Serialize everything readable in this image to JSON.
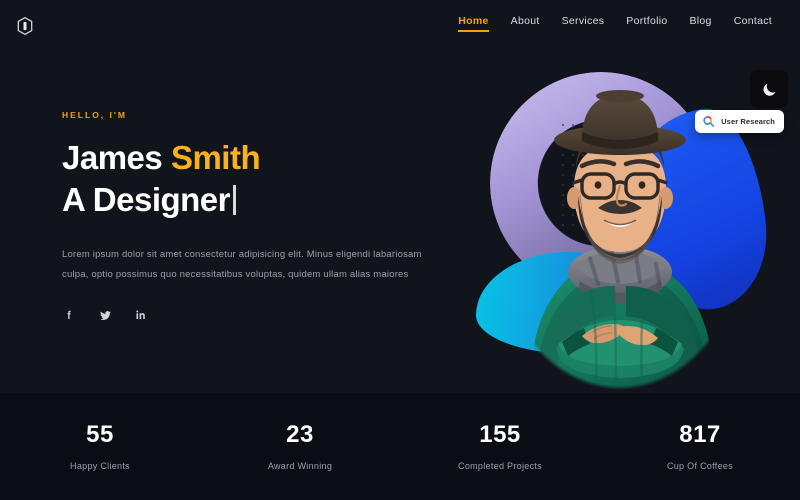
{
  "site": {
    "logo_icon": "monogram-logo-icon",
    "background_color": "#12141c",
    "accent_color": "#eda312"
  },
  "header": {
    "nav": [
      {
        "label": "Home",
        "active": true
      },
      {
        "label": "About",
        "active": false
      },
      {
        "label": "Services",
        "active": false
      },
      {
        "label": "Portfolio",
        "active": false
      },
      {
        "label": "Blog",
        "active": false
      },
      {
        "label": "Contact",
        "active": false
      }
    ]
  },
  "mode_toggle": {
    "icon": "moon-icon",
    "state": "dark"
  },
  "hero": {
    "greeting": "HELLO, I'M",
    "name_first": "James ",
    "name_last": "Smith",
    "role": "A Designer",
    "lead": "Lorem ipsum dolor sit amet consectetur adipisicing elit. Minus eligendi labariosam culpa, optio possimus quo necessitatibus voluptas, quidem ullam alias maiores",
    "socials": [
      {
        "name": "facebook-icon",
        "label": "Facebook"
      },
      {
        "name": "twitter-icon",
        "label": "Twitter"
      },
      {
        "name": "linkedin-icon",
        "label": "LinkedIn"
      }
    ],
    "badge": {
      "text": "User Research",
      "icon": "search-icon"
    },
    "art": {
      "portrait_alt": "Bearded man with hat, glasses, green sweater and grey scarf, arms crossed",
      "ring_color": "#a395d6",
      "blob_blue_color": "#1a4fe8",
      "blob_cyan_color": "#0ab8e0"
    }
  },
  "stats": [
    {
      "value": "55",
      "label": "Happy Clients"
    },
    {
      "value": "23",
      "label": "Award Winning"
    },
    {
      "value": "155",
      "label": "Completed Projects"
    },
    {
      "value": "817",
      "label": "Cup Of Coffees"
    }
  ]
}
